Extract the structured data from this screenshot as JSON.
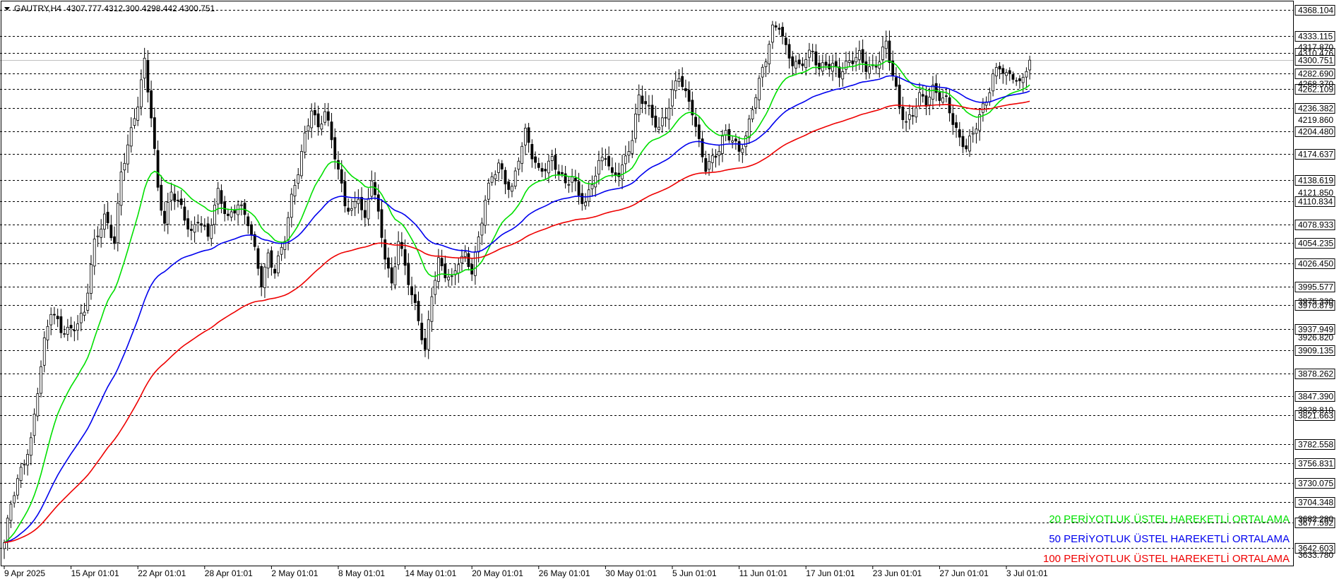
{
  "header": {
    "symbol": "GAUTRY,H4",
    "ohlc": "4307.777 4312.300 4298.442 4300.751"
  },
  "chart_data": {
    "type": "candlestick",
    "symbol": "GAUTRY",
    "timeframe": "H4",
    "ylim": [
      3620,
      4380
    ],
    "last_price": 4300.751,
    "grid": true,
    "y_ticks_boxed": [
      4368.104,
      4333.115,
      4310.476,
      4300.751,
      4282.69,
      4262.109,
      4236.382,
      4204.48,
      4174.637,
      4138.619,
      4110.834,
      4078.933,
      4054.235,
      4026.45,
      3995.577,
      3970.879,
      3937.949,
      3909.135,
      3878.262,
      3847.39,
      3821.663,
      3782.558,
      3756.831,
      3730.075,
      3704.348,
      3677.592,
      3642.603
    ],
    "y_ticks_faint": [
      4317.87,
      4268.37,
      4219.86,
      4121.85,
      3975.33,
      3926.82,
      3828.81,
      3682.28,
      3633.78
    ],
    "x_labels": [
      {
        "label": "9 Apr 2025",
        "i": 0
      },
      {
        "label": "15 Apr 01:01",
        "i": 20
      },
      {
        "label": "22 Apr 01:01",
        "i": 40
      },
      {
        "label": "28 Apr 01:01",
        "i": 60
      },
      {
        "label": "2 May 01:01",
        "i": 80
      },
      {
        "label": "8 May 01:01",
        "i": 100
      },
      {
        "label": "14 May 01:01",
        "i": 120
      },
      {
        "label": "20 May 01:01",
        "i": 140
      },
      {
        "label": "26 May 01:01",
        "i": 160
      },
      {
        "label": "30 May 01:01",
        "i": 180
      },
      {
        "label": "5 Jun 01:01",
        "i": 200
      },
      {
        "label": "11 Jun 01:01",
        "i": 220
      },
      {
        "label": "17 Jun 01:01",
        "i": 240
      },
      {
        "label": "23 Jun 01:01",
        "i": 260
      },
      {
        "label": "27 Jun 01:01",
        "i": 280
      },
      {
        "label": "3 Jul 01:01",
        "i": 300
      }
    ],
    "close_anchors": [
      [
        0,
        3650
      ],
      [
        2,
        3700
      ],
      [
        5,
        3745
      ],
      [
        8,
        3790
      ],
      [
        10,
        3860
      ],
      [
        12,
        3920
      ],
      [
        14,
        3960
      ],
      [
        17,
        3935
      ],
      [
        20,
        3940
      ],
      [
        24,
        3960
      ],
      [
        27,
        4050
      ],
      [
        30,
        4090
      ],
      [
        33,
        4060
      ],
      [
        35,
        4150
      ],
      [
        38,
        4200
      ],
      [
        40,
        4240
      ],
      [
        42,
        4300
      ],
      [
        44,
        4230
      ],
      [
        46,
        4130
      ],
      [
        48,
        4080
      ],
      [
        50,
        4120
      ],
      [
        53,
        4100
      ],
      [
        56,
        4070
      ],
      [
        58,
        4090
      ],
      [
        61,
        4060
      ],
      [
        64,
        4120
      ],
      [
        67,
        4090
      ],
      [
        70,
        4110
      ],
      [
        73,
        4080
      ],
      [
        75,
        4040
      ],
      [
        77,
        4000
      ],
      [
        79,
        4040
      ],
      [
        81,
        4020
      ],
      [
        84,
        4060
      ],
      [
        86,
        4110
      ],
      [
        88,
        4150
      ],
      [
        90,
        4200
      ],
      [
        92,
        4240
      ],
      [
        94,
        4210
      ],
      [
        96,
        4230
      ],
      [
        98,
        4190
      ],
      [
        100,
        4150
      ],
      [
        102,
        4110
      ],
      [
        104,
        4100
      ],
      [
        106,
        4120
      ],
      [
        108,
        4080
      ],
      [
        110,
        4140
      ],
      [
        112,
        4090
      ],
      [
        114,
        4040
      ],
      [
        116,
        4000
      ],
      [
        118,
        4060
      ],
      [
        120,
        4020
      ],
      [
        122,
        3980
      ],
      [
        124,
        3950
      ],
      [
        126,
        3910
      ],
      [
        128,
        3990
      ],
      [
        130,
        4030
      ],
      [
        132,
        4010
      ],
      [
        134,
        4000
      ],
      [
        136,
        4030
      ],
      [
        138,
        4040
      ],
      [
        140,
        4020
      ],
      [
        142,
        4060
      ],
      [
        144,
        4110
      ],
      [
        146,
        4140
      ],
      [
        148,
        4160
      ],
      [
        150,
        4140
      ],
      [
        152,
        4130
      ],
      [
        154,
        4170
      ],
      [
        156,
        4200
      ],
      [
        158,
        4170
      ],
      [
        160,
        4150
      ],
      [
        162,
        4160
      ],
      [
        164,
        4170
      ],
      [
        166,
        4150
      ],
      [
        168,
        4130
      ],
      [
        170,
        4140
      ],
      [
        172,
        4120
      ],
      [
        174,
        4110
      ],
      [
        176,
        4140
      ],
      [
        178,
        4160
      ],
      [
        180,
        4170
      ],
      [
        182,
        4140
      ],
      [
        184,
        4150
      ],
      [
        186,
        4170
      ],
      [
        188,
        4200
      ],
      [
        190,
        4250
      ],
      [
        192,
        4240
      ],
      [
        194,
        4220
      ],
      [
        196,
        4210
      ],
      [
        198,
        4230
      ],
      [
        200,
        4260
      ],
      [
        202,
        4280
      ],
      [
        204,
        4250
      ],
      [
        206,
        4230
      ],
      [
        208,
        4190
      ],
      [
        210,
        4160
      ],
      [
        212,
        4170
      ],
      [
        214,
        4180
      ],
      [
        216,
        4200
      ],
      [
        218,
        4190
      ],
      [
        220,
        4180
      ],
      [
        222,
        4200
      ],
      [
        224,
        4240
      ],
      [
        226,
        4270
      ],
      [
        228,
        4300
      ],
      [
        230,
        4340
      ],
      [
        232,
        4350
      ],
      [
        234,
        4320
      ],
      [
        236,
        4300
      ],
      [
        238,
        4290
      ],
      [
        240,
        4300
      ],
      [
        242,
        4310
      ],
      [
        244,
        4290
      ],
      [
        246,
        4300
      ],
      [
        248,
        4295
      ],
      [
        250,
        4280
      ],
      [
        252,
        4290
      ],
      [
        254,
        4300
      ],
      [
        256,
        4310
      ],
      [
        258,
        4295
      ],
      [
        260,
        4290
      ],
      [
        262,
        4300
      ],
      [
        264,
        4320
      ],
      [
        266,
        4280
      ],
      [
        268,
        4240
      ],
      [
        270,
        4220
      ],
      [
        272,
        4230
      ],
      [
        274,
        4250
      ],
      [
        276,
        4240
      ],
      [
        278,
        4260
      ],
      [
        280,
        4255
      ],
      [
        282,
        4250
      ],
      [
        284,
        4220
      ],
      [
        286,
        4190
      ],
      [
        288,
        4180
      ],
      [
        290,
        4200
      ],
      [
        292,
        4230
      ],
      [
        294,
        4250
      ],
      [
        296,
        4280
      ],
      [
        298,
        4290
      ],
      [
        300,
        4275
      ],
      [
        302,
        4280
      ],
      [
        304,
        4270
      ],
      [
        306,
        4295
      ],
      [
        307,
        4300.751
      ]
    ],
    "series": [
      {
        "name": "20 PERİYOTLUK ÜSTEL HAREKETLİ ORTALAMA",
        "period": 20,
        "color": "#00e000"
      },
      {
        "name": "50 PERİYOTLUK ÜSTEL HAREKETLİ ORTALAMA",
        "period": 50,
        "color": "#0000ee"
      },
      {
        "name": "100 PERİYOTLUK ÜSTEL HAREKETLİ ORTALAMA",
        "period": 100,
        "color": "#ee0000"
      }
    ]
  },
  "colors": {
    "background": "#ffffff",
    "grid": "#000000",
    "candle": "#000000",
    "price_line": "#c0c0c0"
  }
}
